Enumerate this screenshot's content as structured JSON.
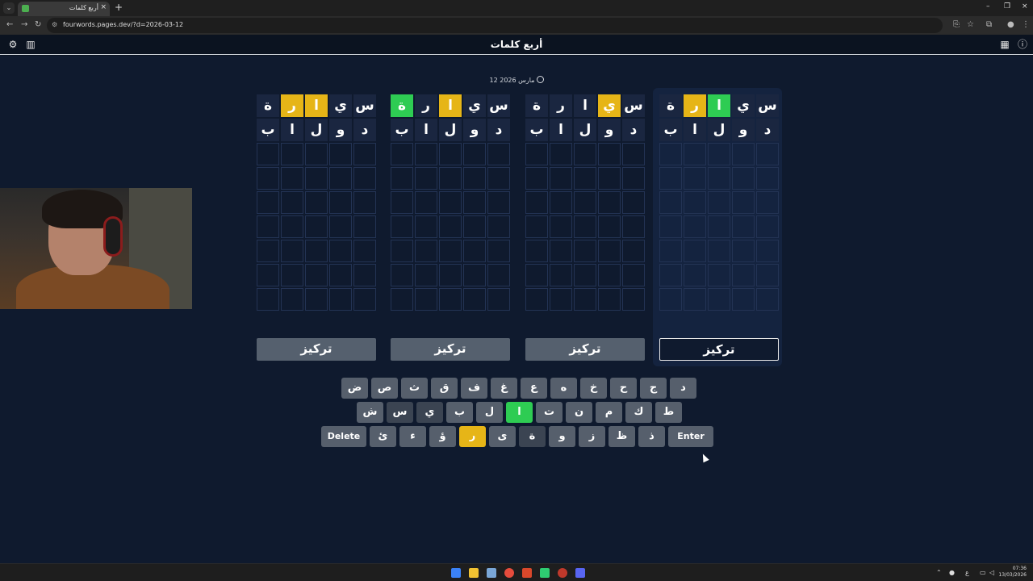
{
  "browser": {
    "tab_title": "أربع كلمات",
    "tab_close": "×",
    "new_tab": "+",
    "url": "fourwords.pages.dev/?d=2026-03-12",
    "window_controls": [
      "–",
      "❐",
      "×"
    ]
  },
  "app": {
    "title": "أربع كلمات",
    "date": "12 مارس 2026",
    "focus_label": "تركيز"
  },
  "colors": {
    "background": "#0f1a2e",
    "correct": "#2ecc53",
    "present": "#e6b517",
    "key_default": "#565f6c"
  },
  "boards": [
    {
      "rows": [
        [
          {
            "l": "س",
            "s": "x"
          },
          {
            "l": "ي",
            "s": "x"
          },
          {
            "l": "ا",
            "s": "y"
          },
          {
            "l": "ر",
            "s": "y"
          },
          {
            "l": "ة",
            "s": "x"
          }
        ],
        [
          {
            "l": "د",
            "s": "x"
          },
          {
            "l": "و",
            "s": "x"
          },
          {
            "l": "ل",
            "s": "x"
          },
          {
            "l": "ا",
            "s": "x"
          },
          {
            "l": "ب",
            "s": "x"
          }
        ]
      ],
      "active": false
    },
    {
      "rows": [
        [
          {
            "l": "س",
            "s": "x"
          },
          {
            "l": "ي",
            "s": "x"
          },
          {
            "l": "ا",
            "s": "y"
          },
          {
            "l": "ر",
            "s": "x"
          },
          {
            "l": "ة",
            "s": "g"
          }
        ],
        [
          {
            "l": "د",
            "s": "x"
          },
          {
            "l": "و",
            "s": "x"
          },
          {
            "l": "ل",
            "s": "x"
          },
          {
            "l": "ا",
            "s": "x"
          },
          {
            "l": "ب",
            "s": "x"
          }
        ]
      ],
      "active": false
    },
    {
      "rows": [
        [
          {
            "l": "س",
            "s": "x"
          },
          {
            "l": "ي",
            "s": "y"
          },
          {
            "l": "ا",
            "s": "x"
          },
          {
            "l": "ر",
            "s": "x"
          },
          {
            "l": "ة",
            "s": "x"
          }
        ],
        [
          {
            "l": "د",
            "s": "x"
          },
          {
            "l": "و",
            "s": "x"
          },
          {
            "l": "ل",
            "s": "x"
          },
          {
            "l": "ا",
            "s": "x"
          },
          {
            "l": "ب",
            "s": "x"
          }
        ]
      ],
      "active": false
    },
    {
      "rows": [
        [
          {
            "l": "س",
            "s": "x"
          },
          {
            "l": "ي",
            "s": "x"
          },
          {
            "l": "ا",
            "s": "g"
          },
          {
            "l": "ر",
            "s": "y"
          },
          {
            "l": "ة",
            "s": "x"
          }
        ],
        [
          {
            "l": "د",
            "s": "x"
          },
          {
            "l": "و",
            "s": "x"
          },
          {
            "l": "ل",
            "s": "x"
          },
          {
            "l": "ا",
            "s": "x"
          },
          {
            "l": "ب",
            "s": "x"
          }
        ]
      ],
      "active": true
    }
  ],
  "keyboard": {
    "row1": [
      {
        "l": "ض",
        "s": ""
      },
      {
        "l": "ص",
        "s": ""
      },
      {
        "l": "ث",
        "s": ""
      },
      {
        "l": "ق",
        "s": ""
      },
      {
        "l": "ف",
        "s": ""
      },
      {
        "l": "غ",
        "s": ""
      },
      {
        "l": "ع",
        "s": ""
      },
      {
        "l": "ه",
        "s": ""
      },
      {
        "l": "خ",
        "s": ""
      },
      {
        "l": "ح",
        "s": ""
      },
      {
        "l": "ج",
        "s": ""
      },
      {
        "l": "د",
        "s": ""
      }
    ],
    "row2": [
      {
        "l": "ش",
        "s": ""
      },
      {
        "l": "س",
        "s": "dark"
      },
      {
        "l": "ي",
        "s": "dark"
      },
      {
        "l": "ب",
        "s": ""
      },
      {
        "l": "ل",
        "s": ""
      },
      {
        "l": "ا",
        "s": "g"
      },
      {
        "l": "ت",
        "s": ""
      },
      {
        "l": "ن",
        "s": ""
      },
      {
        "l": "م",
        "s": ""
      },
      {
        "l": "ك",
        "s": ""
      },
      {
        "l": "ط",
        "s": ""
      }
    ],
    "row3": [
      {
        "l": "Delete",
        "s": "",
        "wide": true
      },
      {
        "l": "ئ",
        "s": ""
      },
      {
        "l": "ء",
        "s": ""
      },
      {
        "l": "ؤ",
        "s": ""
      },
      {
        "l": "ر",
        "s": "y"
      },
      {
        "l": "ى",
        "s": ""
      },
      {
        "l": "ة",
        "s": "dark"
      },
      {
        "l": "و",
        "s": ""
      },
      {
        "l": "ز",
        "s": ""
      },
      {
        "l": "ظ",
        "s": ""
      },
      {
        "l": "ذ",
        "s": ""
      },
      {
        "l": "Enter",
        "s": "",
        "wide": true
      }
    ]
  },
  "taskbar": {
    "time": "07:36",
    "date": "13/03/2026",
    "lang": "ع"
  }
}
